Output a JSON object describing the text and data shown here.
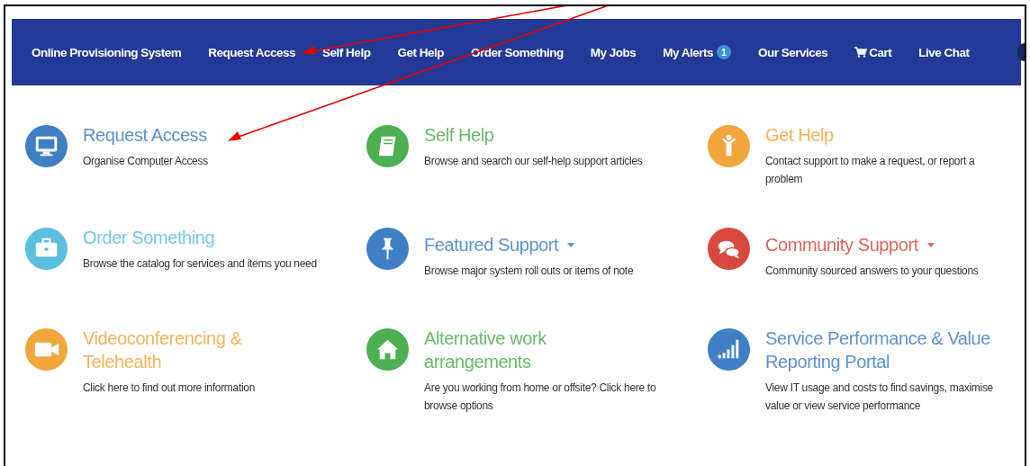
{
  "nav": [
    {
      "label": "Online Provisioning System",
      "kind": "brand"
    },
    {
      "label": "Request Access",
      "kind": "link"
    },
    {
      "label": "Self Help",
      "kind": "link"
    },
    {
      "label": "Get Help",
      "kind": "link"
    },
    {
      "label": "Order Something",
      "kind": "link"
    },
    {
      "label": "My Jobs",
      "kind": "link"
    },
    {
      "label": "My Alerts",
      "kind": "link",
      "badge": "1"
    },
    {
      "label": "Our Services",
      "kind": "link"
    },
    {
      "label": "Cart",
      "kind": "cart"
    },
    {
      "label": "Live Chat",
      "kind": "link"
    }
  ],
  "cards": [
    {
      "title": "Request Access",
      "description": "Organise Computer Access",
      "color": "#3f7fc6",
      "dropdown": false
    },
    {
      "title": "Self Help",
      "description": "Browse and search our self-help support articles",
      "color": "#4caf50",
      "dropdown": false
    },
    {
      "title": "Get Help",
      "description": "Contact support to make a request, or report a problem",
      "color": "#f0a63c",
      "dropdown": false
    },
    {
      "title": "Order Something",
      "description": "Browse the catalog for services and items you need",
      "color": "#5bbfdf",
      "dropdown": false
    },
    {
      "title": "Featured Support",
      "description": "Browse major system roll outs or items of note",
      "color": "#3f7fc6",
      "dropdown": true
    },
    {
      "title": "Community Support",
      "description": "Community sourced answers to your questions",
      "color": "#d9483e",
      "dropdown": true
    },
    {
      "title": "Videoconferencing & Telehealth",
      "description": "Click here to find out more information",
      "color": "#f0a63c",
      "dropdown": false
    },
    {
      "title": "Alternative work arrangements",
      "description": "Are you working from home or offsite? Click here to browse options",
      "color": "#4caf50",
      "dropdown": false
    },
    {
      "title": "Service Performance & Value Reporting Portal",
      "description": "View IT usage and costs to find savings, maximise value or view service performance",
      "color": "#3f7fc6",
      "dropdown": false
    }
  ]
}
